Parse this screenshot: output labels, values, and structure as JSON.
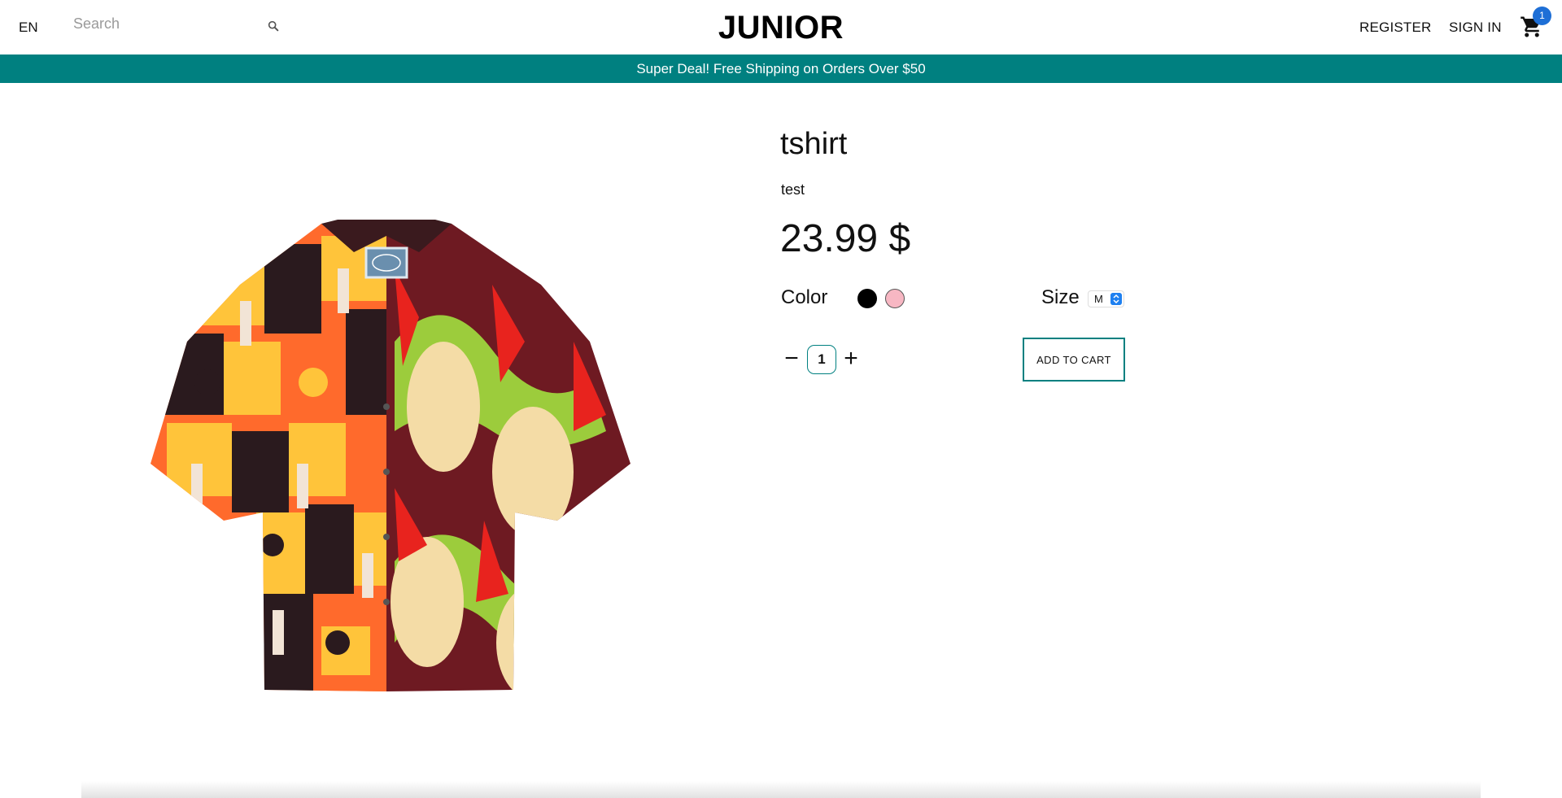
{
  "header": {
    "language": "EN",
    "search_placeholder": "Search",
    "logo": "JUNIOR",
    "register_label": "REGISTER",
    "sign_in_label": "SIGN IN",
    "cart_count": "1",
    "icons": {
      "search": "search-icon",
      "cart": "cart-icon"
    }
  },
  "banner": {
    "text": "Super Deal! Free Shipping on Orders Over $50",
    "color": "#008080"
  },
  "product": {
    "title": "tshirt",
    "description": "test",
    "price": "23.99 $",
    "color_label": "Color",
    "colors": [
      "#000000",
      "#f7b7c3"
    ],
    "size_label": "Size",
    "size_selected": "M",
    "quantity": "1",
    "minus_label": "−",
    "plus_label": "+",
    "add_to_cart_label": "ADD TO CART"
  },
  "colors": {
    "accent": "#008080",
    "badge": "#1e6fd6"
  }
}
